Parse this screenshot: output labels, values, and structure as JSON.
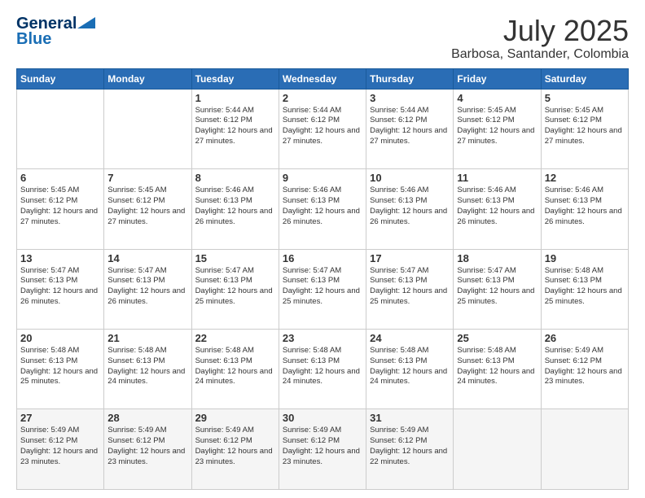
{
  "logo": {
    "line1": "General",
    "line2": "Blue"
  },
  "title": "July 2025",
  "location": "Barbosa, Santander, Colombia",
  "days_of_week": [
    "Sunday",
    "Monday",
    "Tuesday",
    "Wednesday",
    "Thursday",
    "Friday",
    "Saturday"
  ],
  "weeks": [
    [
      {
        "day": "",
        "info": ""
      },
      {
        "day": "",
        "info": ""
      },
      {
        "day": "1",
        "info": "Sunrise: 5:44 AM\nSunset: 6:12 PM\nDaylight: 12 hours and 27 minutes."
      },
      {
        "day": "2",
        "info": "Sunrise: 5:44 AM\nSunset: 6:12 PM\nDaylight: 12 hours and 27 minutes."
      },
      {
        "day": "3",
        "info": "Sunrise: 5:44 AM\nSunset: 6:12 PM\nDaylight: 12 hours and 27 minutes."
      },
      {
        "day": "4",
        "info": "Sunrise: 5:45 AM\nSunset: 6:12 PM\nDaylight: 12 hours and 27 minutes."
      },
      {
        "day": "5",
        "info": "Sunrise: 5:45 AM\nSunset: 6:12 PM\nDaylight: 12 hours and 27 minutes."
      }
    ],
    [
      {
        "day": "6",
        "info": "Sunrise: 5:45 AM\nSunset: 6:12 PM\nDaylight: 12 hours and 27 minutes."
      },
      {
        "day": "7",
        "info": "Sunrise: 5:45 AM\nSunset: 6:12 PM\nDaylight: 12 hours and 27 minutes."
      },
      {
        "day": "8",
        "info": "Sunrise: 5:46 AM\nSunset: 6:13 PM\nDaylight: 12 hours and 26 minutes."
      },
      {
        "day": "9",
        "info": "Sunrise: 5:46 AM\nSunset: 6:13 PM\nDaylight: 12 hours and 26 minutes."
      },
      {
        "day": "10",
        "info": "Sunrise: 5:46 AM\nSunset: 6:13 PM\nDaylight: 12 hours and 26 minutes."
      },
      {
        "day": "11",
        "info": "Sunrise: 5:46 AM\nSunset: 6:13 PM\nDaylight: 12 hours and 26 minutes."
      },
      {
        "day": "12",
        "info": "Sunrise: 5:46 AM\nSunset: 6:13 PM\nDaylight: 12 hours and 26 minutes."
      }
    ],
    [
      {
        "day": "13",
        "info": "Sunrise: 5:47 AM\nSunset: 6:13 PM\nDaylight: 12 hours and 26 minutes."
      },
      {
        "day": "14",
        "info": "Sunrise: 5:47 AM\nSunset: 6:13 PM\nDaylight: 12 hours and 26 minutes."
      },
      {
        "day": "15",
        "info": "Sunrise: 5:47 AM\nSunset: 6:13 PM\nDaylight: 12 hours and 25 minutes."
      },
      {
        "day": "16",
        "info": "Sunrise: 5:47 AM\nSunset: 6:13 PM\nDaylight: 12 hours and 25 minutes."
      },
      {
        "day": "17",
        "info": "Sunrise: 5:47 AM\nSunset: 6:13 PM\nDaylight: 12 hours and 25 minutes."
      },
      {
        "day": "18",
        "info": "Sunrise: 5:47 AM\nSunset: 6:13 PM\nDaylight: 12 hours and 25 minutes."
      },
      {
        "day": "19",
        "info": "Sunrise: 5:48 AM\nSunset: 6:13 PM\nDaylight: 12 hours and 25 minutes."
      }
    ],
    [
      {
        "day": "20",
        "info": "Sunrise: 5:48 AM\nSunset: 6:13 PM\nDaylight: 12 hours and 25 minutes."
      },
      {
        "day": "21",
        "info": "Sunrise: 5:48 AM\nSunset: 6:13 PM\nDaylight: 12 hours and 24 minutes."
      },
      {
        "day": "22",
        "info": "Sunrise: 5:48 AM\nSunset: 6:13 PM\nDaylight: 12 hours and 24 minutes."
      },
      {
        "day": "23",
        "info": "Sunrise: 5:48 AM\nSunset: 6:13 PM\nDaylight: 12 hours and 24 minutes."
      },
      {
        "day": "24",
        "info": "Sunrise: 5:48 AM\nSunset: 6:13 PM\nDaylight: 12 hours and 24 minutes."
      },
      {
        "day": "25",
        "info": "Sunrise: 5:48 AM\nSunset: 6:13 PM\nDaylight: 12 hours and 24 minutes."
      },
      {
        "day": "26",
        "info": "Sunrise: 5:49 AM\nSunset: 6:12 PM\nDaylight: 12 hours and 23 minutes."
      }
    ],
    [
      {
        "day": "27",
        "info": "Sunrise: 5:49 AM\nSunset: 6:12 PM\nDaylight: 12 hours and 23 minutes."
      },
      {
        "day": "28",
        "info": "Sunrise: 5:49 AM\nSunset: 6:12 PM\nDaylight: 12 hours and 23 minutes."
      },
      {
        "day": "29",
        "info": "Sunrise: 5:49 AM\nSunset: 6:12 PM\nDaylight: 12 hours and 23 minutes."
      },
      {
        "day": "30",
        "info": "Sunrise: 5:49 AM\nSunset: 6:12 PM\nDaylight: 12 hours and 23 minutes."
      },
      {
        "day": "31",
        "info": "Sunrise: 5:49 AM\nSunset: 6:12 PM\nDaylight: 12 hours and 22 minutes."
      },
      {
        "day": "",
        "info": ""
      },
      {
        "day": "",
        "info": ""
      }
    ]
  ]
}
